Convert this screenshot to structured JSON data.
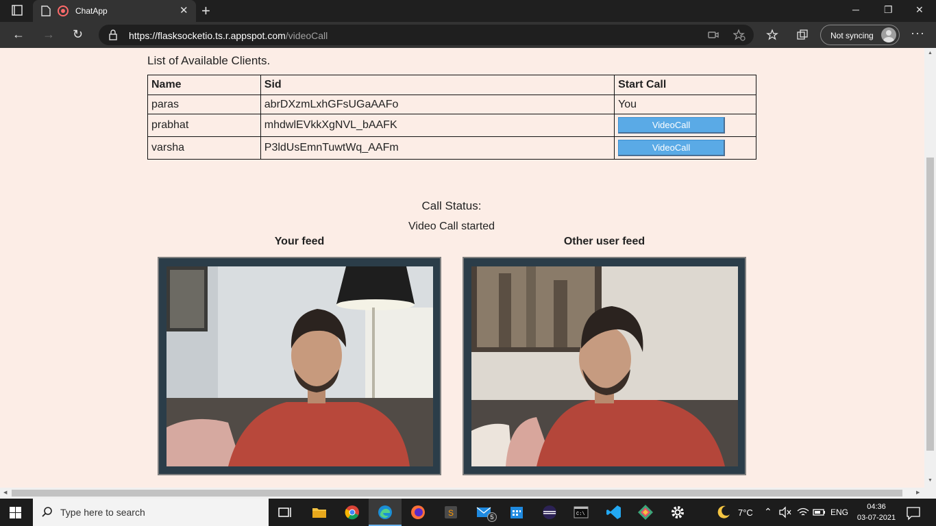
{
  "browser": {
    "tab_title": "ChatApp",
    "new_tab_symbol": "+",
    "url_host": "https://flasksocketio.ts.r.appspot.com",
    "url_path": "/videoCall",
    "sync_label": "Not syncing"
  },
  "page": {
    "list_title": "List of Available Clients.",
    "table": {
      "headers": [
        "Name",
        "Sid",
        "Start Call"
      ],
      "rows": [
        {
          "name": "paras",
          "sid": "abrDXzmLxhGFsUGaAAFo",
          "action": "You"
        },
        {
          "name": "prabhat",
          "sid": "mhdwlEVkkXgNVL_bAAFK",
          "action": "VideoCall"
        },
        {
          "name": "varsha",
          "sid": "P3ldUsEmnTuwtWq_AAFm",
          "action": "VideoCall"
        }
      ]
    },
    "call_status_label": "Call Status:",
    "call_status": "Video Call started",
    "your_feed_label": "Your feed",
    "other_feed_label": "Other user feed"
  },
  "taskbar": {
    "search_placeholder": "Type here to search",
    "mail_badge": "5",
    "weather": "7°C",
    "language": "ENG",
    "time": "04:36",
    "date": "03-07-2021"
  },
  "colors": {
    "page_bg": "#fcede6",
    "button_bg": "#5aaae6",
    "frame_bg": "#2b3d49",
    "browser_chrome": "#333333"
  }
}
